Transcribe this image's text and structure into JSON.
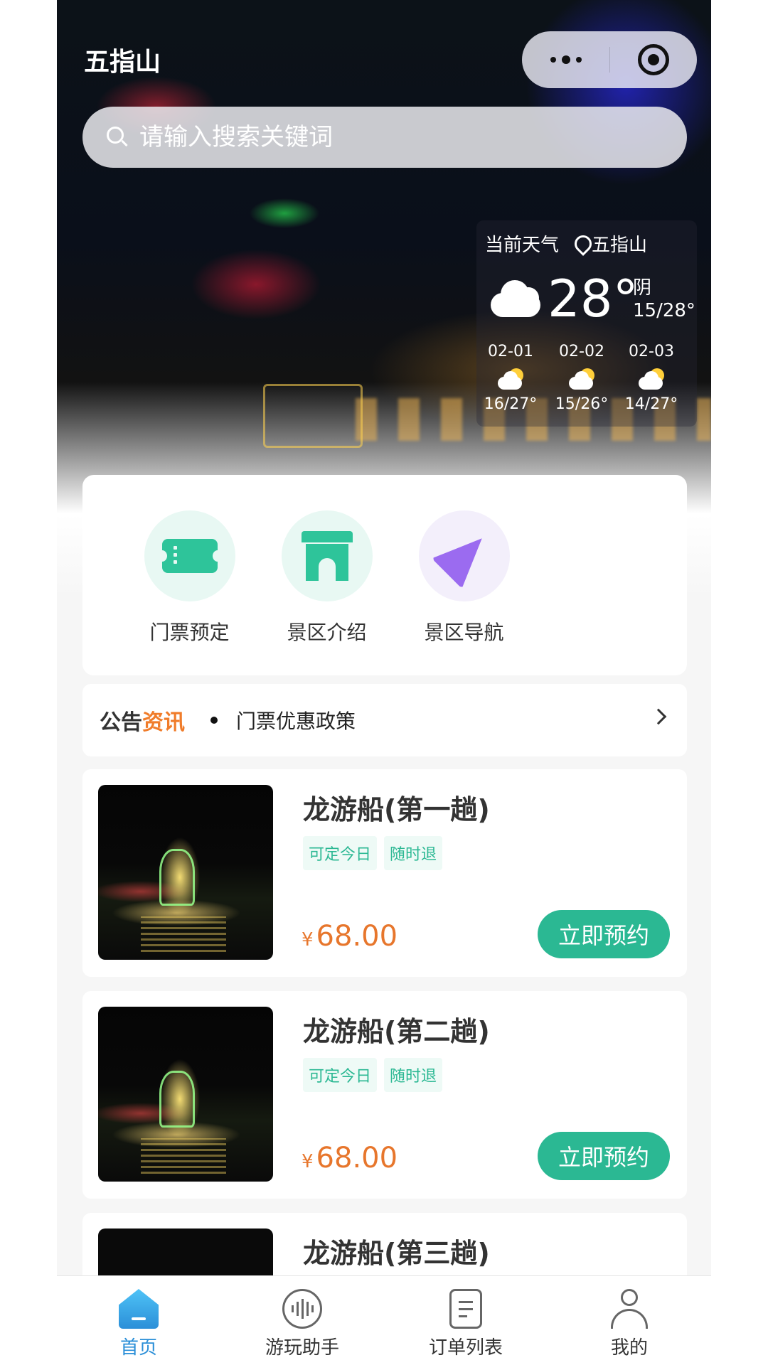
{
  "header": {
    "title": "五指山",
    "search_placeholder": "请输入搜索关键词"
  },
  "weather": {
    "label": "当前天气",
    "location": "五指山",
    "temp": "28°",
    "condition": "阴",
    "range": "15/28°",
    "forecast": [
      {
        "date": "02-01",
        "range": "16/27°"
      },
      {
        "date": "02-02",
        "range": "15/26°"
      },
      {
        "date": "02-03",
        "range": "14/27°"
      }
    ]
  },
  "quick_menu": [
    {
      "label": "门票预定",
      "icon": "ticket-icon"
    },
    {
      "label": "景区介绍",
      "icon": "gate-icon"
    },
    {
      "label": "景区导航",
      "icon": "navigation-icon"
    }
  ],
  "notice": {
    "tag_part1": "公告",
    "tag_part2": "资讯",
    "text": "门票优惠政策"
  },
  "products": [
    {
      "title": "龙游船(第一趟)",
      "tags": [
        "可定今日",
        "随时退"
      ],
      "currency": "¥",
      "price": "68.00",
      "button": "立即预约"
    },
    {
      "title": "龙游船(第二趟)",
      "tags": [
        "可定今日",
        "随时退"
      ],
      "currency": "¥",
      "price": "68.00",
      "button": "立即预约"
    },
    {
      "title": "龙游船(第三趟)"
    }
  ],
  "tabbar": [
    {
      "label": "首页",
      "icon": "home-icon",
      "active": true
    },
    {
      "label": "游玩助手",
      "icon": "voice-assistant-icon"
    },
    {
      "label": "订单列表",
      "icon": "order-list-icon"
    },
    {
      "label": "我的",
      "icon": "user-icon"
    }
  ],
  "colors": {
    "accent": "#2bb893",
    "price": "#e7762c",
    "tab_active": "#2b8fd8",
    "notice_highlight": "#f07c2a"
  }
}
